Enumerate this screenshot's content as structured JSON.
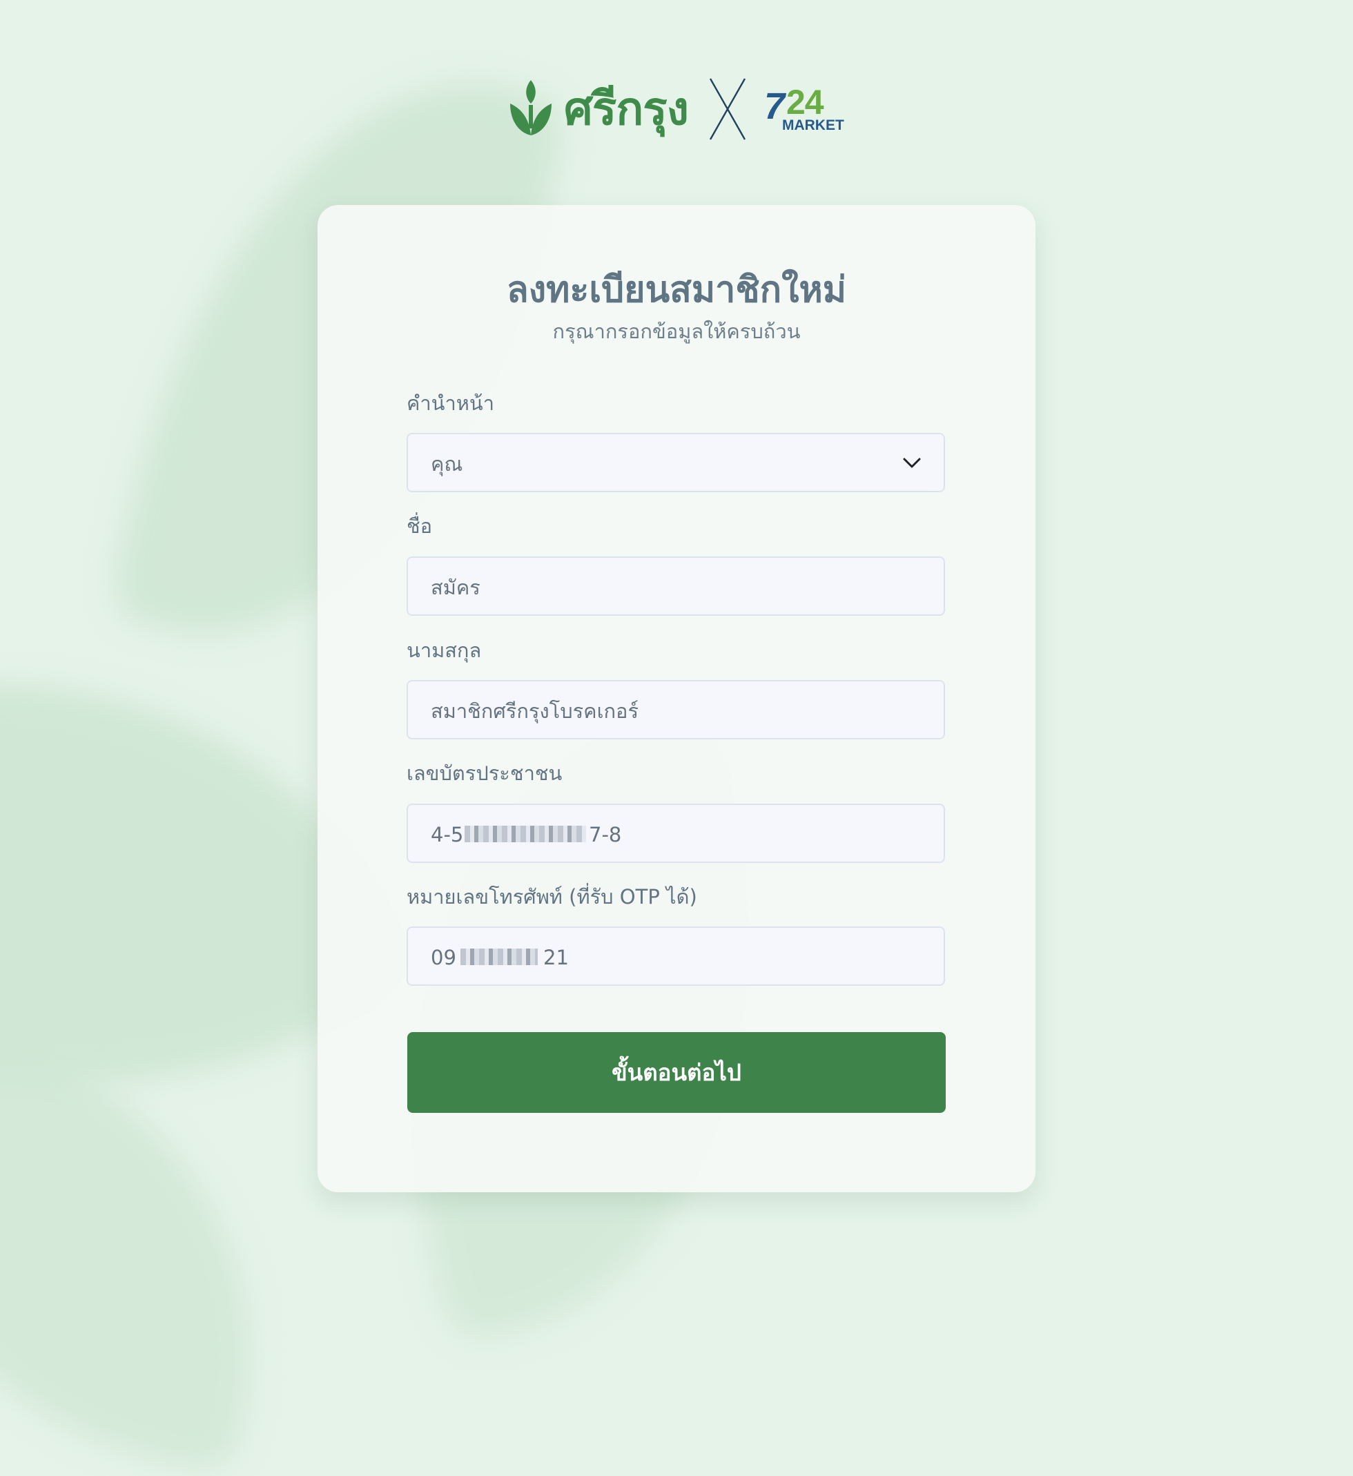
{
  "brand": {
    "name": "ศรีกรุง",
    "partner_number": "24",
    "partner_word": "MARKET",
    "partner_seven": "7",
    "colors": {
      "brand_green": "#3f8b4a",
      "partner_blue": "#275a8c",
      "partner_green": "#6bad45",
      "button_green": "#3e844a",
      "background": "#e5f3e8"
    }
  },
  "form": {
    "title": "ลงทะเบียนสมาชิกใหม่",
    "subtitle": "กรุณากรอกข้อมูลให้ครบถ้วน",
    "fields": {
      "prefix": {
        "label": "คำนำหน้า",
        "value": "คุณ",
        "icon": "chevron-down-icon"
      },
      "first_name": {
        "label": "ชื่อ",
        "value": "สมัคร"
      },
      "last_name": {
        "label": "นามสกุล",
        "value": "สมาชิกศรีกรุงโบรคเกอร์"
      },
      "id_card": {
        "label": "เลขบัตรประชาชน",
        "value_start": "4-5",
        "value_end": "7-8"
      },
      "phone": {
        "label": "หมายเลขโทรศัพท์ (ที่รับ OTP ได้)",
        "value_start": "09",
        "value_end": "21"
      }
    },
    "submit_label": "ขั้นตอนต่อไป"
  }
}
